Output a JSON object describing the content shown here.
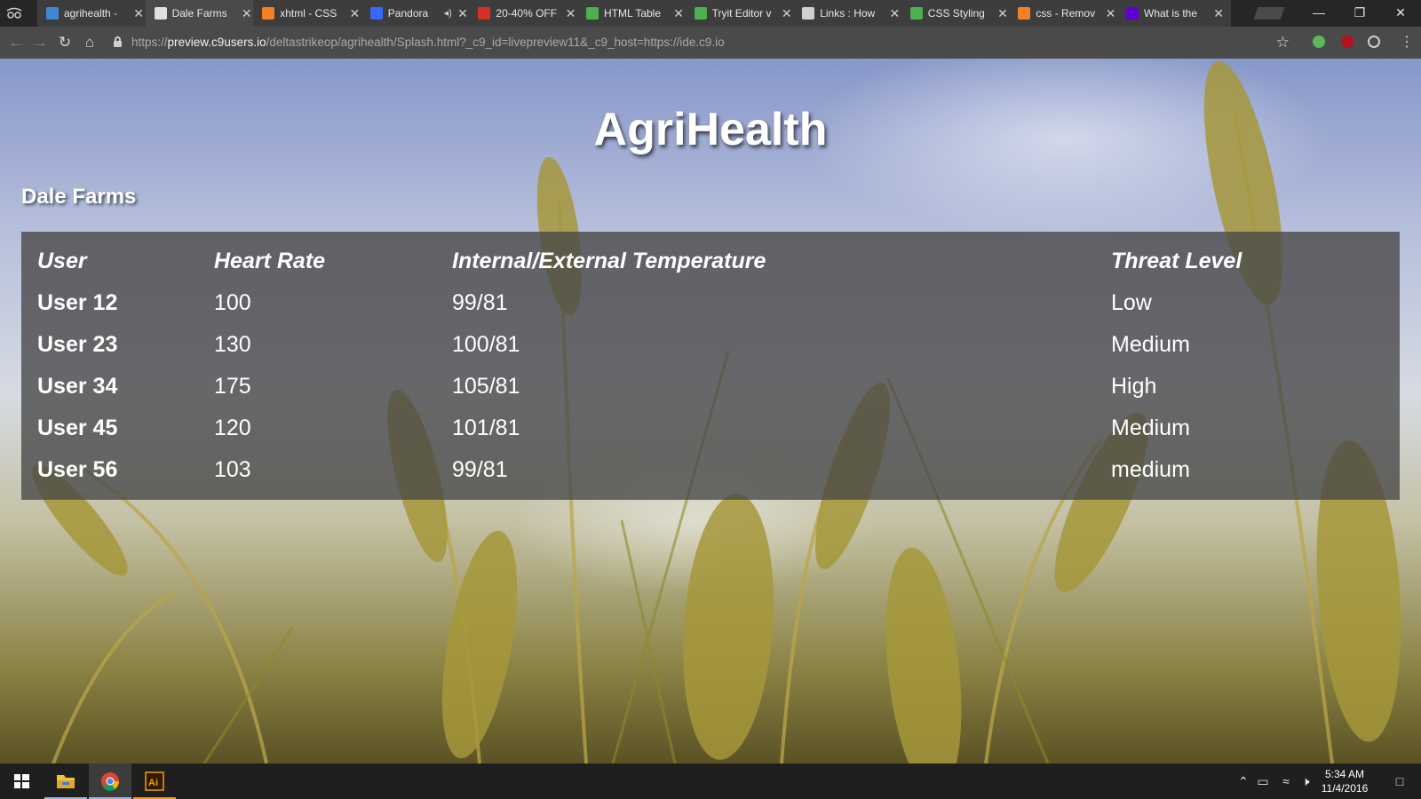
{
  "browser": {
    "tabs": [
      {
        "title": "agrihealth - ",
        "favicon": "cloud9-icon",
        "color": "#3f88d6",
        "active": false
      },
      {
        "title": "Dale Farms",
        "favicon": "page-icon",
        "color": "#e0e0e0",
        "active": true
      },
      {
        "title": "xhtml - CSS",
        "favicon": "stackoverflow-icon",
        "color": "#f48024",
        "active": false
      },
      {
        "title": "Pandora",
        "favicon": "pandora-icon",
        "color": "#3668ff",
        "active": false,
        "audio": true
      },
      {
        "title": "20-40% OFF",
        "favicon": "gmail-icon",
        "color": "#d93025",
        "active": false
      },
      {
        "title": "HTML Table",
        "favicon": "w3schools-icon",
        "color": "#4caf50",
        "active": false
      },
      {
        "title": "Tryit Editor v",
        "favicon": "w3schools-icon",
        "color": "#4caf50",
        "active": false
      },
      {
        "title": "Links : How",
        "favicon": "globe-icon",
        "color": "#d0d0d0",
        "active": false
      },
      {
        "title": "CSS Styling",
        "favicon": "w3schools-icon",
        "color": "#4caf50",
        "active": false
      },
      {
        "title": "css - Remov",
        "favicon": "stackoverflow-icon",
        "color": "#f48024",
        "active": false
      },
      {
        "title": "What is the",
        "favicon": "yahoo-icon",
        "color": "#6001d2",
        "active": false
      }
    ],
    "url_scheme": "https://",
    "url_host": "preview.c9users.io",
    "url_path": "/deltastrikeop/agrihealth/Splash.html?_c9_id=livepreview11&_c9_host=https://ide.c9.io"
  },
  "page": {
    "title": "AgriHealth",
    "farm_name": "Dale Farms",
    "table": {
      "headers": [
        "User",
        "Heart Rate",
        "Internal/External Temperature",
        "Threat Level"
      ],
      "rows": [
        [
          "User 12",
          "100",
          "99/81",
          "Low"
        ],
        [
          "User 23",
          "130",
          "100/81",
          "Medium"
        ],
        [
          "User 34",
          "175",
          "105/81",
          "High"
        ],
        [
          "User 45",
          "120",
          "101/81",
          "Medium"
        ],
        [
          "User 56",
          "103",
          "99/81",
          "medium"
        ]
      ]
    }
  },
  "taskbar": {
    "time": "5:34 AM",
    "date": "11/4/2016",
    "apps": [
      "start-icon",
      "file-explorer-icon",
      "chrome-icon",
      "illustrator-icon"
    ]
  }
}
